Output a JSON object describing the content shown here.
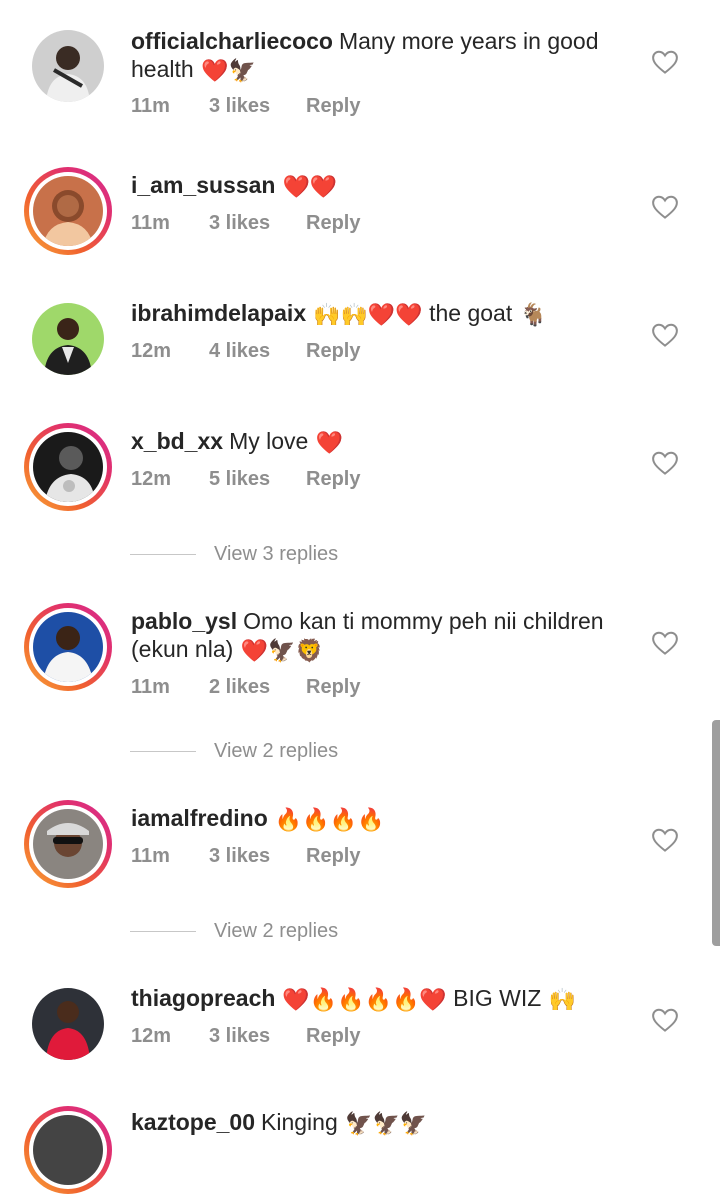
{
  "comments": [
    {
      "username": "officialcharliecoco",
      "text": "Many more years in good health",
      "emoji": "❤️🦅",
      "time": "11m",
      "likes": "3 likes",
      "reply": "Reply",
      "story": false
    },
    {
      "username": "i_am_sussan",
      "text": "",
      "emoji": "❤️❤️",
      "time": "11m",
      "likes": "3 likes",
      "reply": "Reply",
      "story": true
    },
    {
      "username": "ibrahimdelapaix",
      "text": "",
      "emoji": "🙌🙌❤️❤️",
      "text2": "the goat",
      "emoji2": "🐐",
      "time": "12m",
      "likes": "4 likes",
      "reply": "Reply",
      "story": false
    },
    {
      "username": "x_bd_xx",
      "text": "My love",
      "emoji": "❤️",
      "time": "12m",
      "likes": "5 likes",
      "reply": "Reply",
      "story": true,
      "view_replies": "View 3 replies"
    },
    {
      "username": "pablo_ysl",
      "text": "Omo kan ti mommy peh nii children (ekun nla)",
      "emoji": "❤️🦅🦁",
      "time": "11m",
      "likes": "2 likes",
      "reply": "Reply",
      "story": true,
      "view_replies": "View 2 replies"
    },
    {
      "username": "iamalfredino",
      "text": "",
      "emoji": "🔥🔥🔥🔥",
      "time": "11m",
      "likes": "3 likes",
      "reply": "Reply",
      "story": true,
      "view_replies": "View 2 replies"
    },
    {
      "username": "thiagopreach",
      "text": "",
      "emoji": "❤️🔥🔥🔥🔥❤️",
      "text2": "BIG WIZ",
      "emoji2": "🙌",
      "time": "12m",
      "likes": "3 likes",
      "reply": "Reply",
      "story": false
    },
    {
      "username": "kaztope_00",
      "text": "Kinging",
      "emoji": "🦅🦅🦅",
      "story": true
    }
  ],
  "colors": {
    "story_ring_start": "#f9a93a",
    "story_ring_end": "#d62e92",
    "muted": "#8e8e8e",
    "text": "#262626"
  },
  "icons": {
    "like": "heart-outline-icon"
  }
}
